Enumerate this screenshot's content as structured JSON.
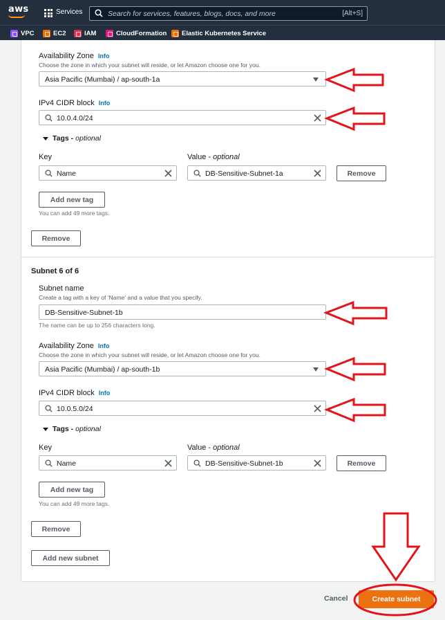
{
  "nav": {
    "logo": "aws",
    "services_label": "Services",
    "search_placeholder": "Search for services, features, blogs, docs, and more",
    "search_shortcut": "[Alt+S]"
  },
  "favorites": [
    {
      "label": "VPC",
      "icon": "vpc-icon",
      "color": "#8c4fff"
    },
    {
      "label": "EC2",
      "icon": "ec2-icon",
      "color": "#ed7100"
    },
    {
      "label": "IAM",
      "icon": "iam-icon",
      "color": "#dd344c"
    },
    {
      "label": "CloudFormation",
      "icon": "cloudformation-icon",
      "color": "#e7157b"
    },
    {
      "label": "Elastic Kubernetes Service",
      "icon": "eks-icon",
      "color": "#ed7100"
    }
  ],
  "subnet5": {
    "az_label": "Availability Zone",
    "az_info": "Info",
    "az_desc": "Choose the zone in which your subnet will reside, or let Amazon choose one for you.",
    "az_value": "Asia Pacific (Mumbai) / ap-south-1a",
    "cidr_label": "IPv4 CIDR block",
    "cidr_info": "Info",
    "cidr_value": "10.0.4.0/24",
    "tags_label": "Tags -",
    "tags_optional": "optional",
    "key_label": "Key",
    "value_label": "Value -",
    "value_optional": "optional",
    "tag_key": "Name",
    "tag_value": "DB-Sensitive-Subnet-1a",
    "remove_tag_label": "Remove",
    "add_tag_label": "Add new tag",
    "tags_remaining": "You can add 49 more tags.",
    "remove_subnet_label": "Remove"
  },
  "subnet6": {
    "heading": "Subnet 6 of 6",
    "name_label": "Subnet name",
    "name_desc": "Create a tag with a key of 'Name' and a value that you specify.",
    "name_value": "DB-Sensitive-Subnet-1b",
    "name_hint": "The name can be up to 256 characters long.",
    "az_label": "Availability Zone",
    "az_info": "Info",
    "az_desc": "Choose the zone in which your subnet will reside, or let Amazon choose one for you.",
    "az_value": "Asia Pacific (Mumbai) / ap-south-1b",
    "cidr_label": "IPv4 CIDR block",
    "cidr_info": "Info",
    "cidr_value": "10.0.5.0/24",
    "tags_label": "Tags -",
    "tags_optional": "optional",
    "key_label": "Key",
    "value_label": "Value -",
    "value_optional": "optional",
    "tag_key": "Name",
    "tag_value": "DB-Sensitive-Subnet-1b",
    "remove_tag_label": "Remove",
    "add_tag_label": "Add new tag",
    "tags_remaining": "You can add 49 more tags.",
    "remove_subnet_label": "Remove"
  },
  "add_subnet_label": "Add new subnet",
  "footer": {
    "cancel_label": "Cancel",
    "create_label": "Create subnet"
  },
  "colors": {
    "nav_bg": "#232f3e",
    "accent_orange": "#ec7211",
    "link_blue": "#0073bb",
    "annotation_red": "#e3151a"
  }
}
